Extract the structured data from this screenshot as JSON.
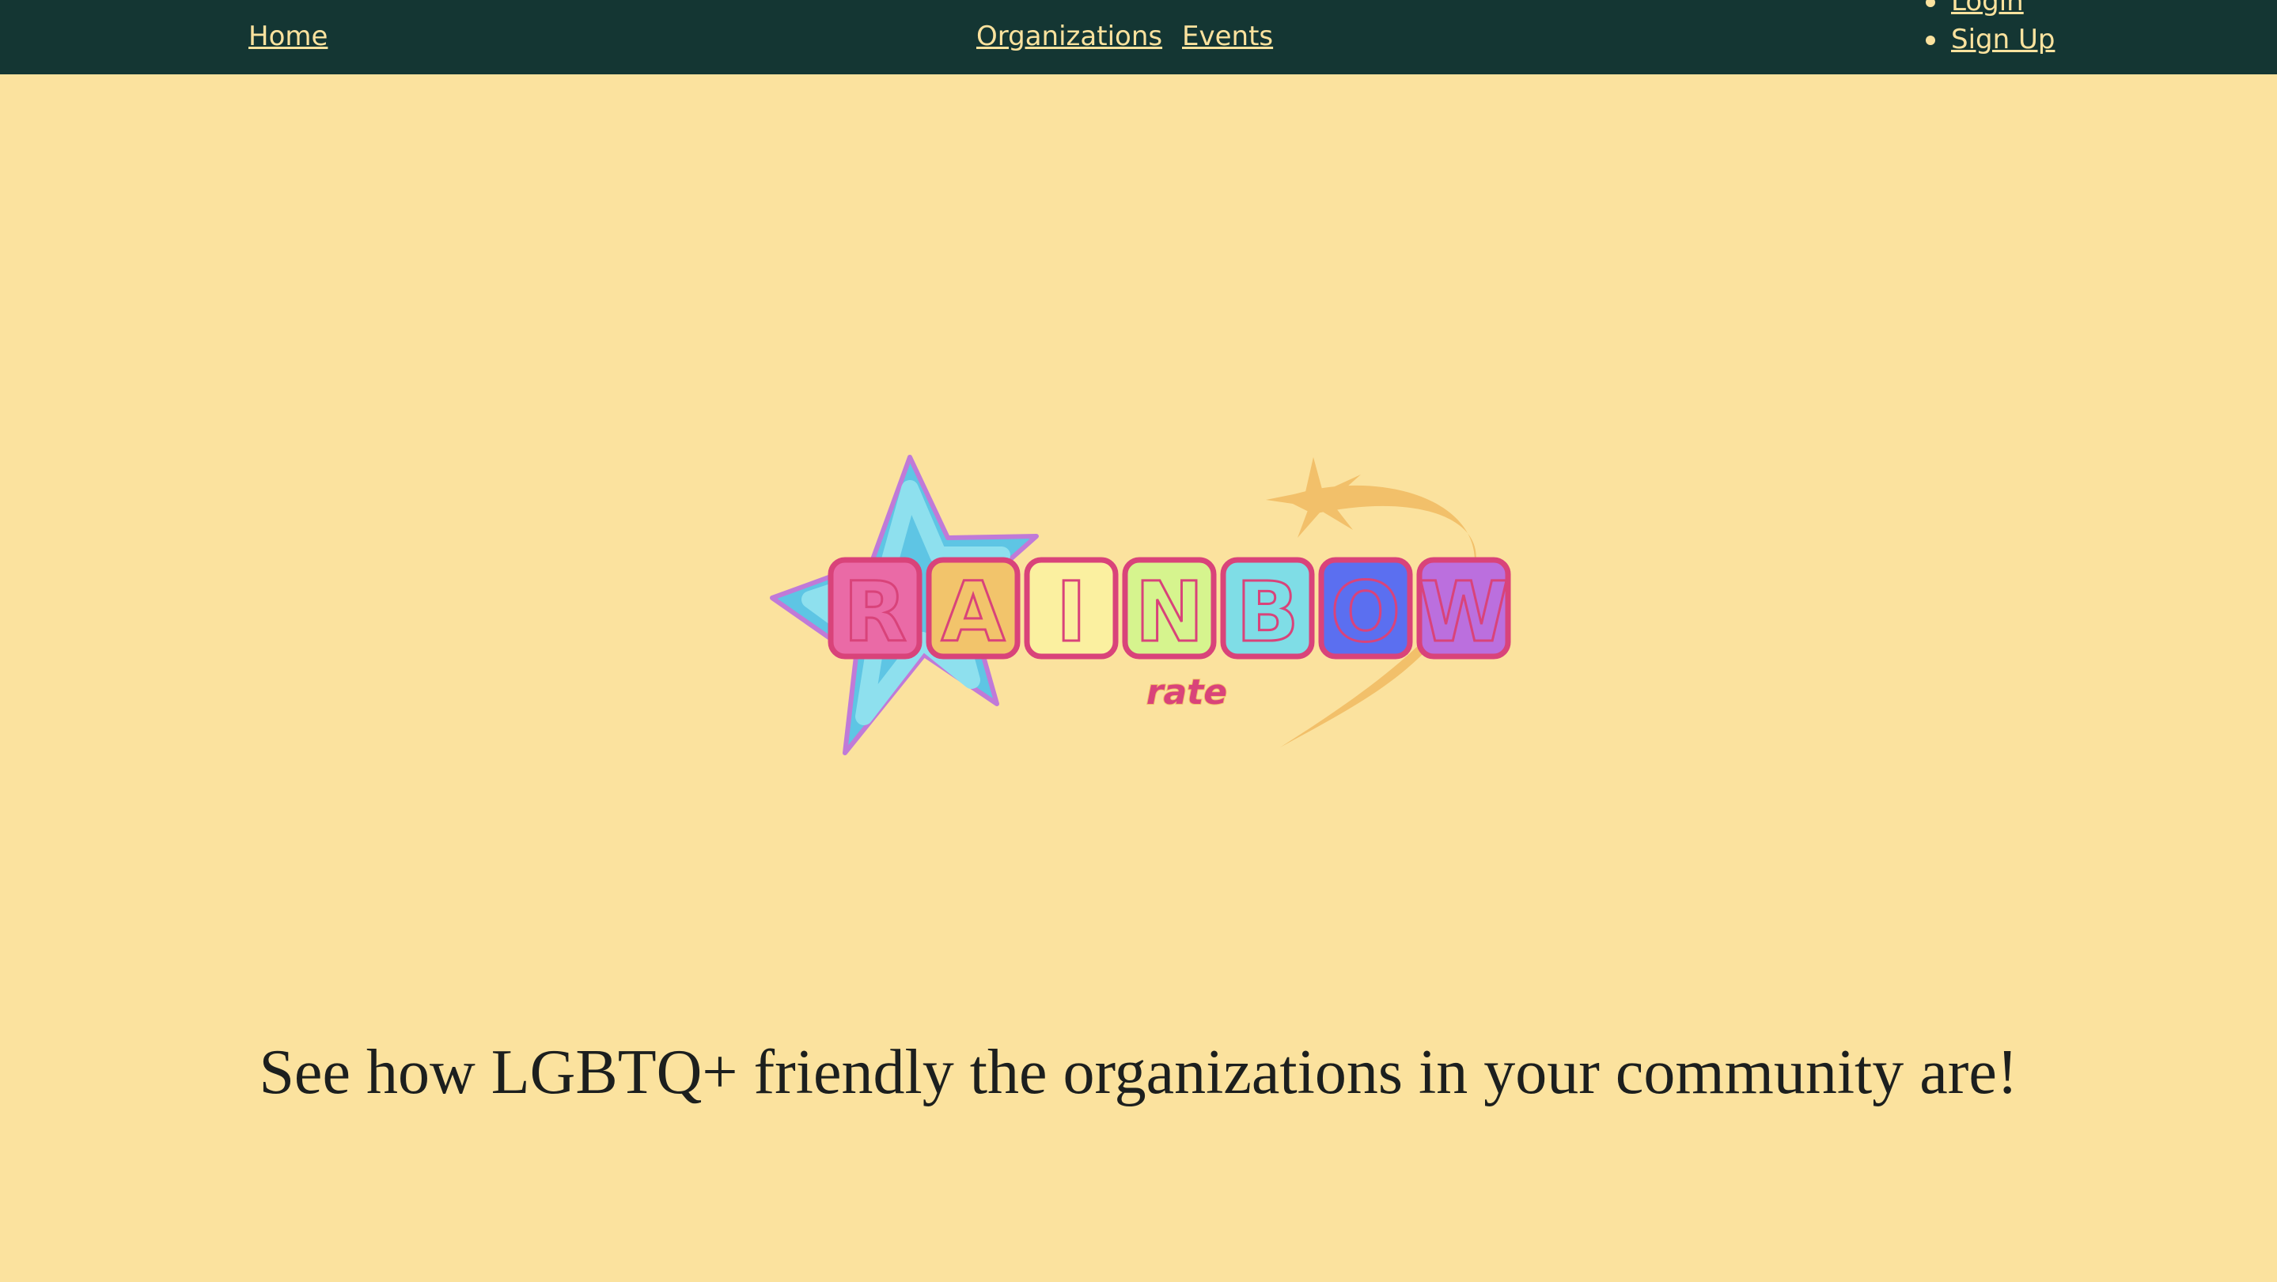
{
  "nav": {
    "home": "Home",
    "organizations": "Organizations",
    "events": "Events",
    "login": "Login",
    "signup": "Sign Up"
  },
  "logo": {
    "letters": [
      "R",
      "A",
      "I",
      "N",
      "B",
      "O",
      "W"
    ],
    "subtitle": "rate",
    "letter_colors": [
      "#ea6aa6",
      "#f2c46b",
      "#fbf0a0",
      "#d6f48e",
      "#7fdde6",
      "#5b6ff0",
      "#bb6fde"
    ],
    "outline_color": "#d9437a",
    "star_color": "#5ec5e4",
    "swoosh_color": "#f2c06a"
  },
  "hero": {
    "tagline": "See how LGBTQ+ friendly the organizations in your community are!"
  },
  "colors": {
    "navbar": "#143633",
    "background": "#fbe29e",
    "link": "#fbe29e",
    "text": "#1c1f1e"
  }
}
